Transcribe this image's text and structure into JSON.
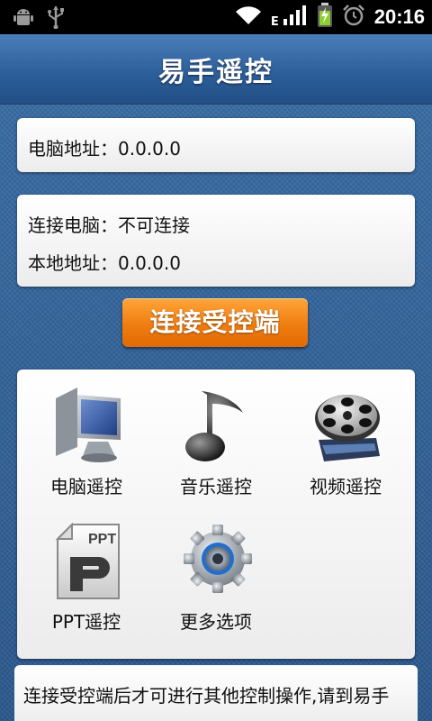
{
  "status_bar": {
    "network_type": "E",
    "time": "20:16",
    "icons": [
      "android-debug-icon",
      "usb-icon",
      "wifi-icon",
      "signal-icon",
      "battery-charging-icon",
      "alarm-icon"
    ]
  },
  "app": {
    "title": "易手遥控"
  },
  "info_card_1": {
    "computer_address": "电脑地址：0.0.0.0"
  },
  "info_card_2": {
    "connected_computer": "连接电脑：不可连接",
    "local_address": "本地地址：0.0.0.0"
  },
  "connect_button": {
    "label": "连接受控端"
  },
  "grid": {
    "items": [
      {
        "label": "电脑遥控",
        "icon": "computer-icon"
      },
      {
        "label": "音乐遥控",
        "icon": "music-note-icon"
      },
      {
        "label": "视频遥控",
        "icon": "film-reel-icon"
      },
      {
        "label": "PPT遥控",
        "icon": "ppt-icon",
        "icon_text": "PPT"
      },
      {
        "label": "更多选项",
        "icon": "gear-icon"
      }
    ]
  },
  "notice": {
    "text": "连接受控端后才可进行其他控制操作,请到易手"
  }
}
